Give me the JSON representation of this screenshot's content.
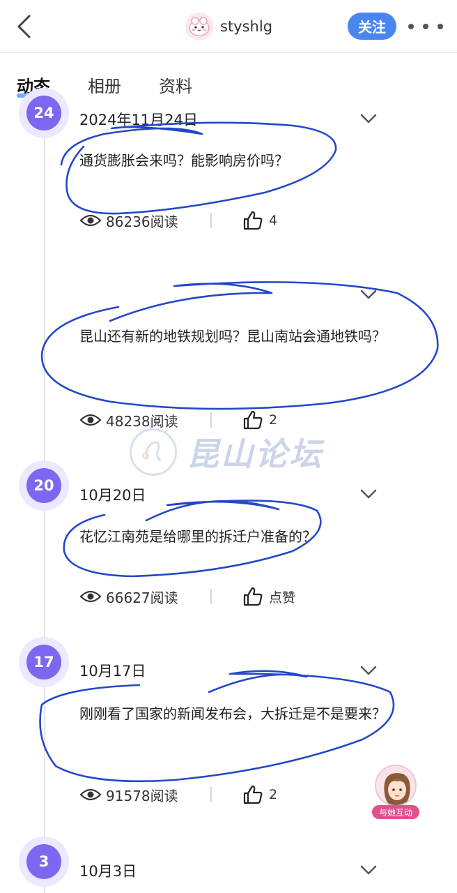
{
  "header": {
    "username": "styshlg",
    "follow_label": "关注"
  },
  "tabs": [
    "动态",
    "相册",
    "资料"
  ],
  "posts": [
    {
      "day": "24",
      "date": "2024年11月24日",
      "text": "通货膨胀会来吗？能影响房价吗？",
      "views": "86236阅读",
      "likes": "4"
    },
    {
      "day": "",
      "date": "",
      "text": "昆山还有新的地铁规划吗？昆山南站会通地铁吗？",
      "views": "48238阅读",
      "likes": "2"
    },
    {
      "day": "20",
      "date": "10月20日",
      "text": "花忆江南苑是给哪里的拆迁户准备的？",
      "views": "66627阅读",
      "likes": "点赞"
    },
    {
      "day": "17",
      "date": "10月17日",
      "text": "刚刚看了国家的新闻发布会，大拆迁是不是要来？",
      "views": "91578阅读",
      "likes": "2"
    },
    {
      "day": "3",
      "date": "10月3日"
    }
  ],
  "watermark": "昆山论坛",
  "float_interact": {
    "label": "与她互动"
  },
  "colors": {
    "accent": "#4a86ee",
    "badge": "#7b68f0",
    "pen": "#2447c8",
    "interact": "#e24f8f"
  }
}
